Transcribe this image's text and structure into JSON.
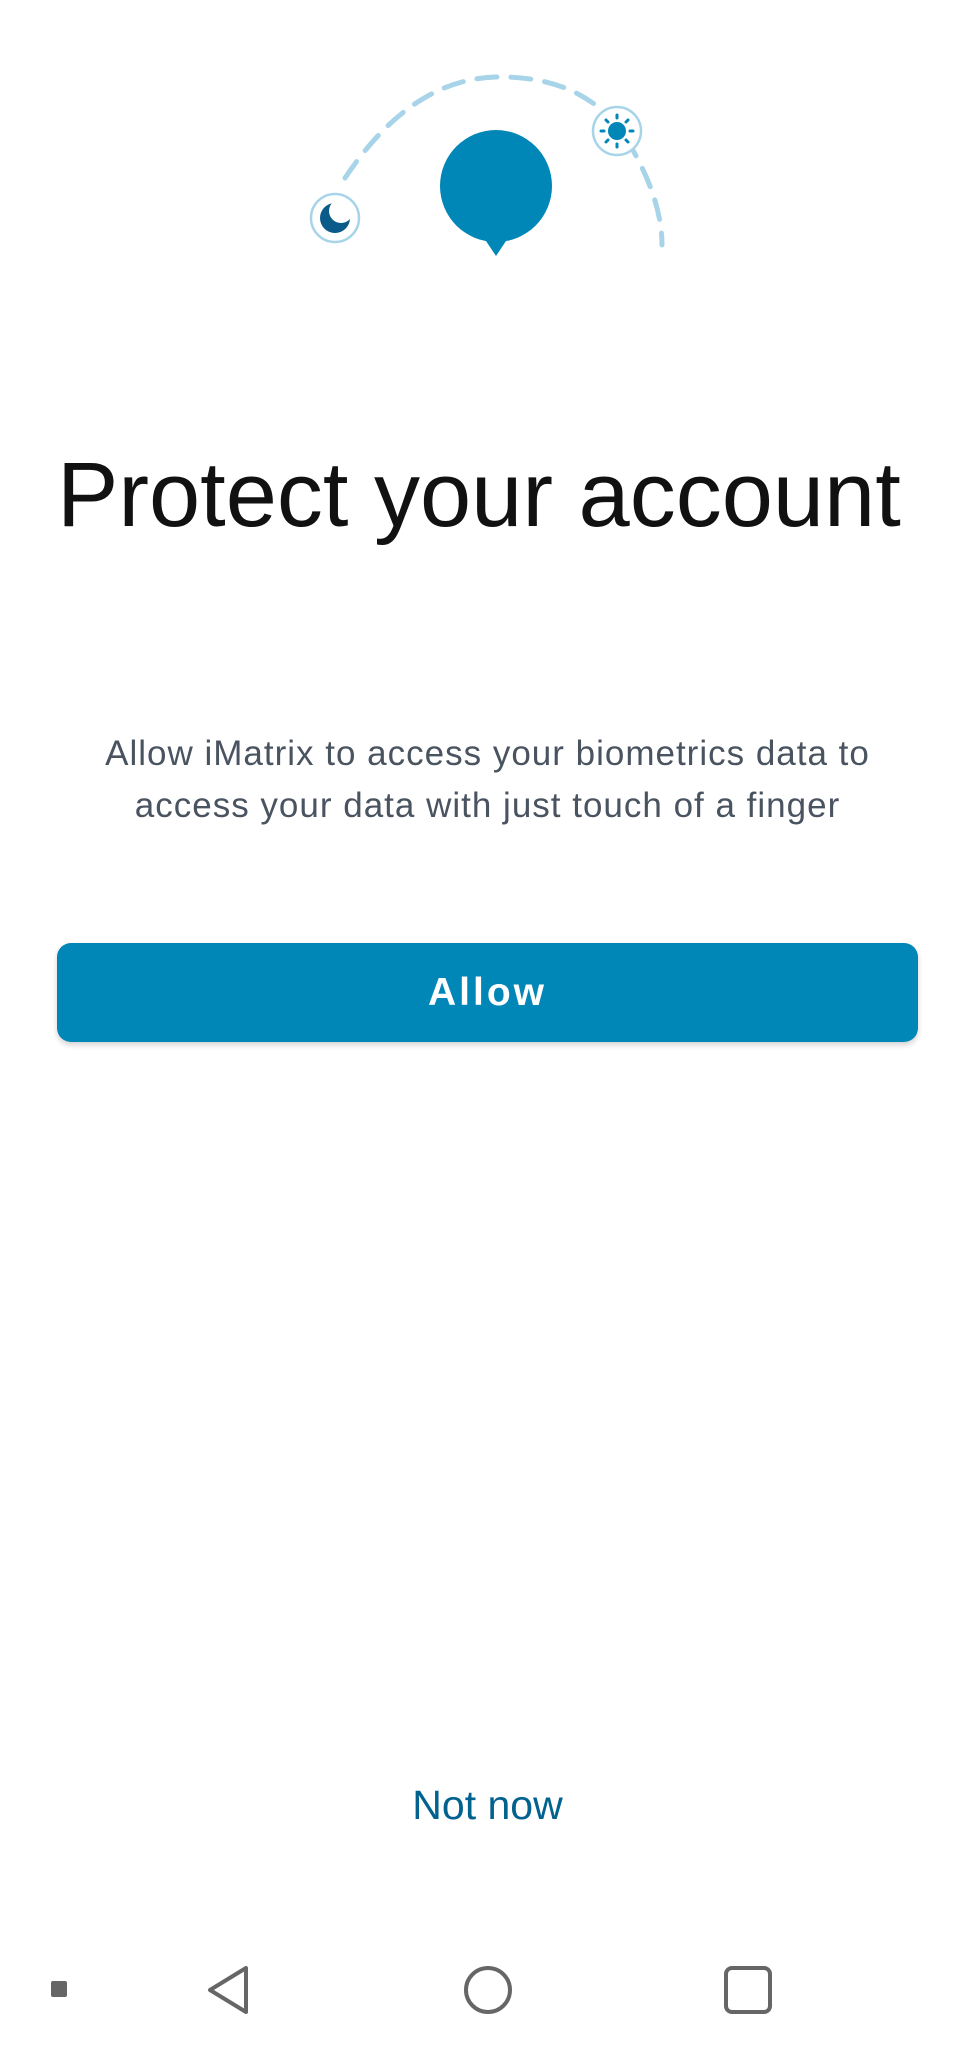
{
  "hero": {
    "moon_icon": "moon-icon",
    "sun_icon": "sun-icon",
    "marker_icon": "map-pin-icon",
    "colors": {
      "primary": "#0186b8",
      "dash": "#a7d4e8",
      "dark_blue": "#0a5a8a"
    }
  },
  "title": "Protect your account",
  "description": "Allow iMatrix to access your biometrics data to access your data with just touch of a finger",
  "allow_button": {
    "label": "Allow",
    "color": "#0186b8"
  },
  "not_now": {
    "label": "Not now",
    "color": "#02628f"
  },
  "system_nav": {
    "items": [
      "menu-dot-icon",
      "back-icon",
      "home-icon",
      "recents-icon"
    ]
  }
}
